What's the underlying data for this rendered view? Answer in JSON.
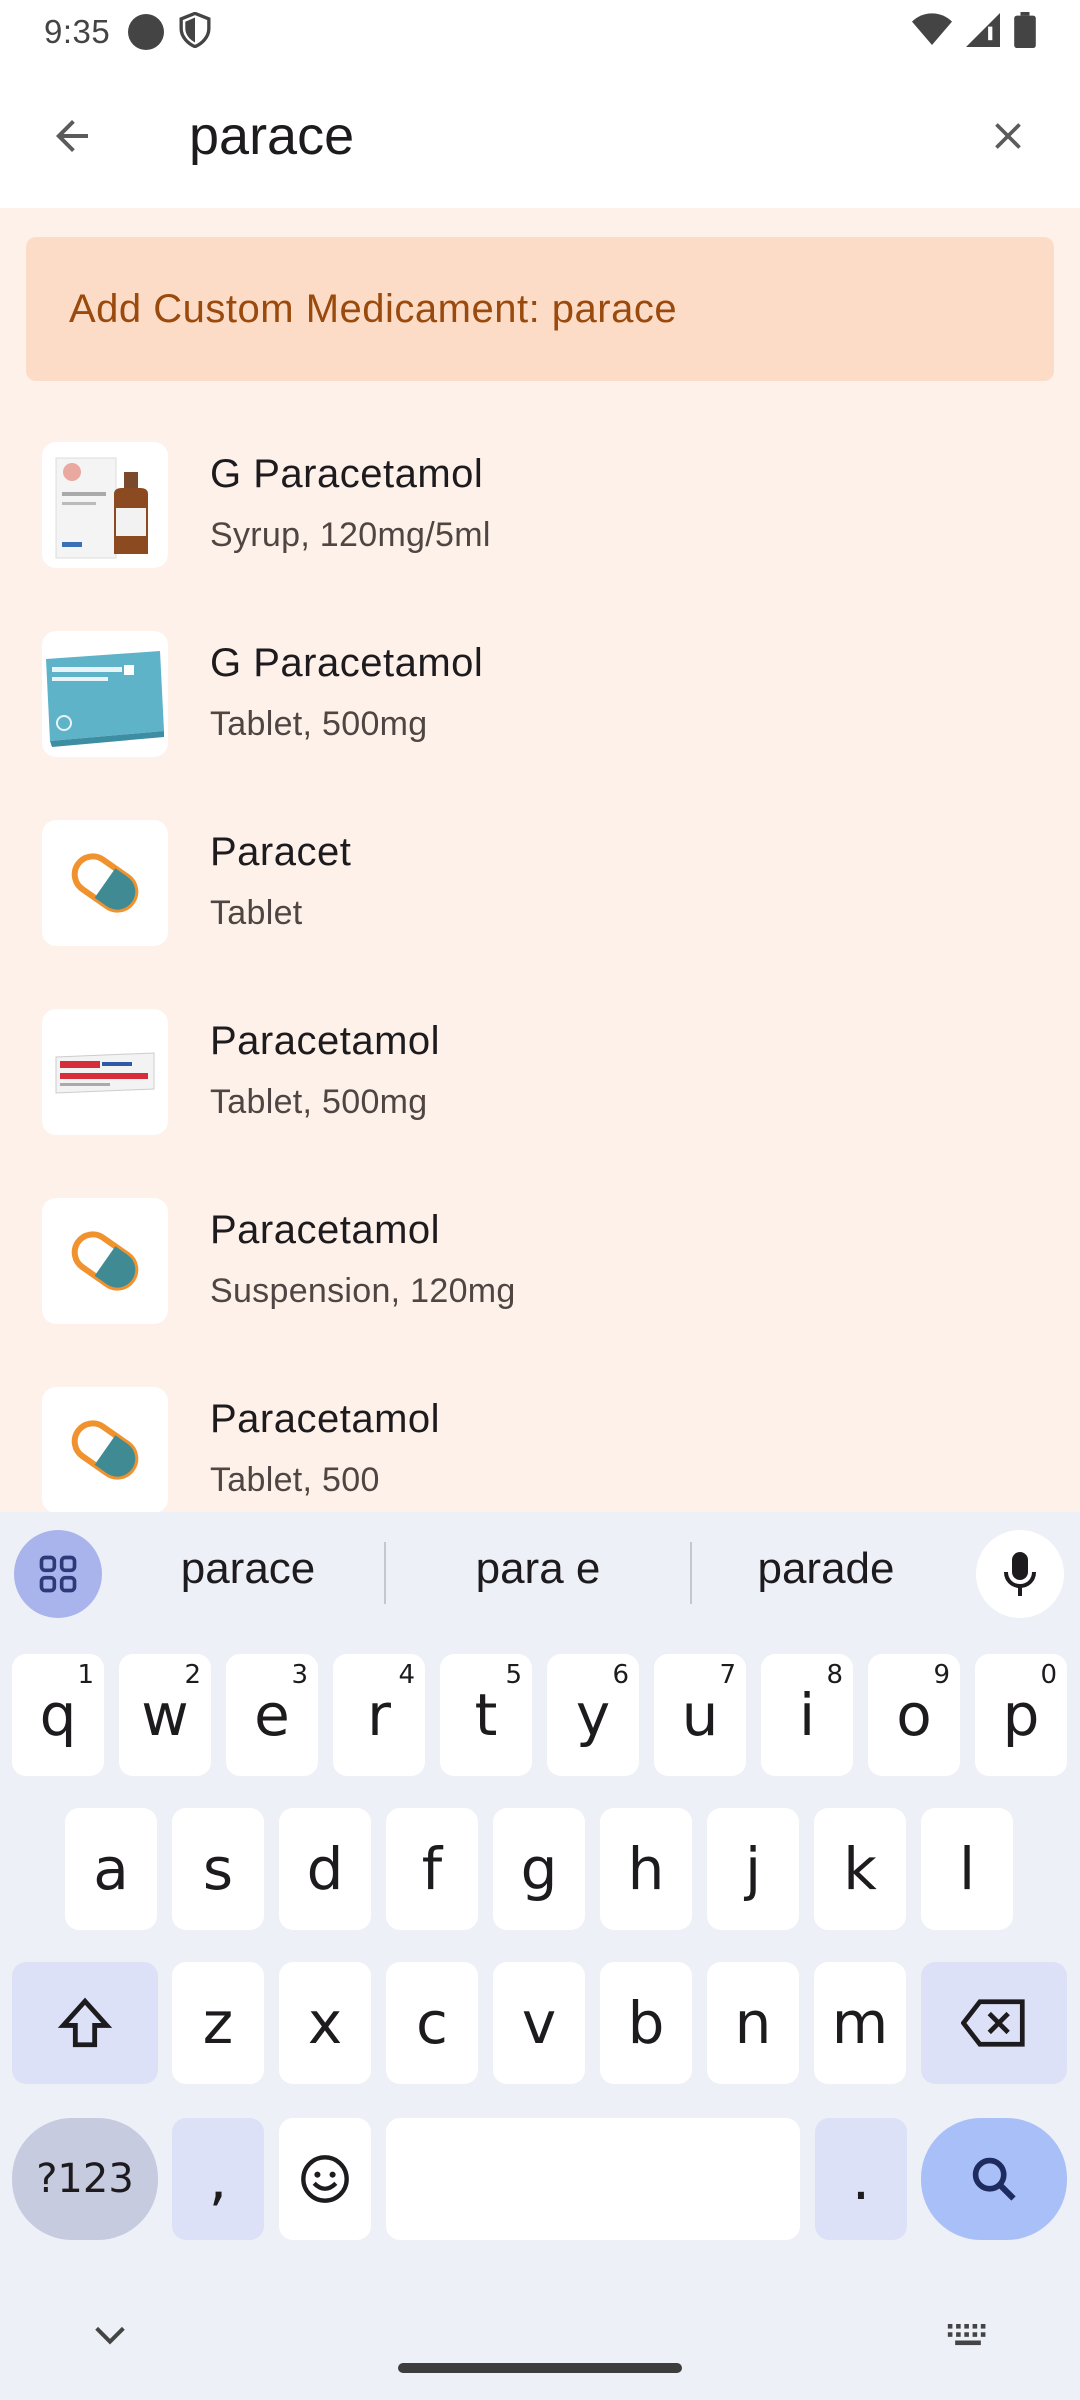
{
  "status_bar": {
    "time": "9:35"
  },
  "app_bar": {
    "query": "parace",
    "back_icon": "arrow-back-icon",
    "clear_icon": "close-icon"
  },
  "custom_button": {
    "label": "Add Custom Medicament: parace"
  },
  "results": [
    {
      "title": "G Paracetamol",
      "subtitle": "Syrup, 120mg/5ml",
      "thumb": "syrup-bottle-photo"
    },
    {
      "title": "G Paracetamol",
      "subtitle": "Tablet, 500mg",
      "thumb": "blue-box-photo"
    },
    {
      "title": "Paracet",
      "subtitle": "Tablet",
      "thumb": "pill-icon"
    },
    {
      "title": "Paracetamol",
      "subtitle": "Tablet, 500mg",
      "thumb": "white-box-photo"
    },
    {
      "title": "Paracetamol",
      "subtitle": "Suspension, 120mg",
      "thumb": "pill-icon"
    },
    {
      "title": "Paracetamol",
      "subtitle": "Tablet, 500",
      "thumb": "pill-icon"
    }
  ],
  "keyboard": {
    "suggestions": [
      "parace",
      "para e",
      "parade"
    ],
    "row1": [
      {
        "key": "q",
        "sup": "1"
      },
      {
        "key": "w",
        "sup": "2"
      },
      {
        "key": "e",
        "sup": "3"
      },
      {
        "key": "r",
        "sup": "4"
      },
      {
        "key": "t",
        "sup": "5"
      },
      {
        "key": "y",
        "sup": "6"
      },
      {
        "key": "u",
        "sup": "7"
      },
      {
        "key": "i",
        "sup": "8"
      },
      {
        "key": "o",
        "sup": "9"
      },
      {
        "key": "p",
        "sup": "0"
      }
    ],
    "row2": [
      "a",
      "s",
      "d",
      "f",
      "g",
      "h",
      "j",
      "k",
      "l"
    ],
    "row3": [
      "z",
      "x",
      "c",
      "v",
      "b",
      "n",
      "m"
    ],
    "num_key": "?123",
    "comma_key": ",",
    "period_key": "."
  },
  "colors": {
    "background": "#fdf1e9",
    "custom_button_bg": "#fddcc7",
    "custom_button_text": "#9a4a0c",
    "pill_orange": "#f0922e",
    "pill_teal": "#3f8a93"
  }
}
